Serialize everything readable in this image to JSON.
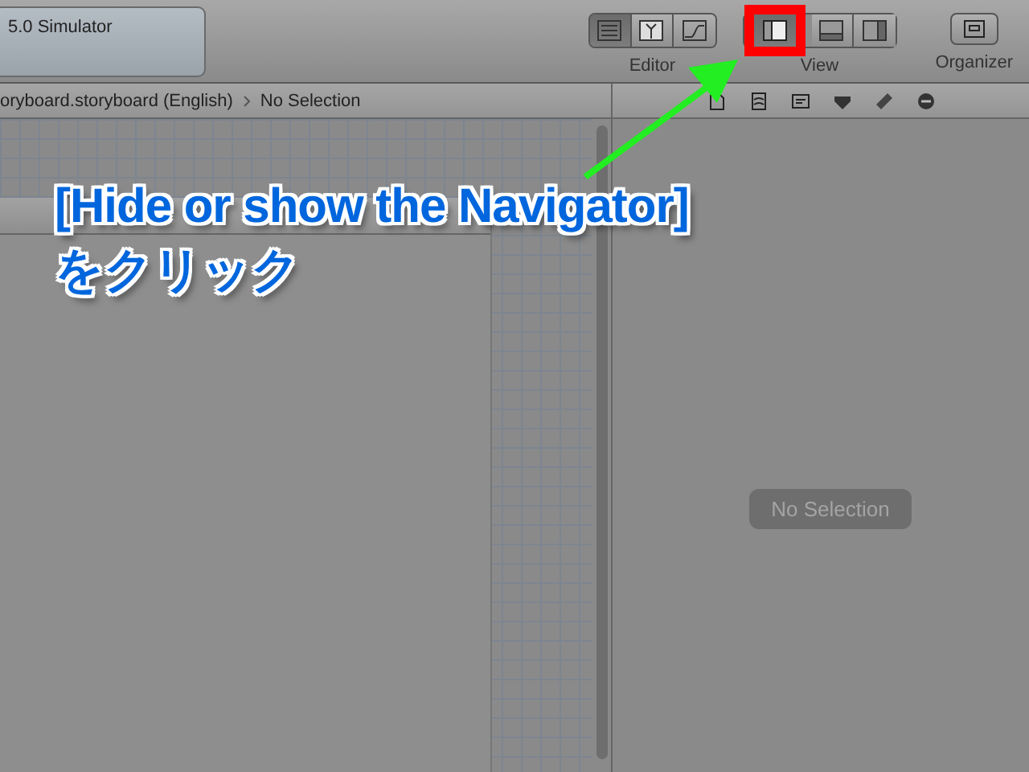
{
  "toolbar": {
    "scheme": "5.0 Simulator",
    "editor_buttons": [
      {
        "kind": "standard",
        "selected": true
      },
      {
        "kind": "assistant",
        "selected": false
      },
      {
        "kind": "version",
        "selected": false
      }
    ],
    "view_buttons": [
      {
        "kind": "navigator",
        "selected": true,
        "highlighted": true
      },
      {
        "kind": "debug",
        "selected": false,
        "highlighted": false
      },
      {
        "kind": "utilities",
        "selected": false,
        "highlighted": false
      }
    ],
    "labels": [
      "Editor",
      "View",
      "Organizer"
    ]
  },
  "jump_bar": [
    "oryboard.storyboard (English)",
    "No Selection"
  ],
  "inspector": {
    "tabs": [
      {
        "kind": "file"
      },
      {
        "kind": "quick-help"
      },
      {
        "kind": "identity"
      },
      {
        "kind": "attributes"
      },
      {
        "kind": "size"
      },
      {
        "kind": "connections"
      }
    ],
    "message": "No Selection"
  },
  "annotation": {
    "lines": [
      "[Hide or show the Navigator]",
      "をクリック"
    ]
  }
}
